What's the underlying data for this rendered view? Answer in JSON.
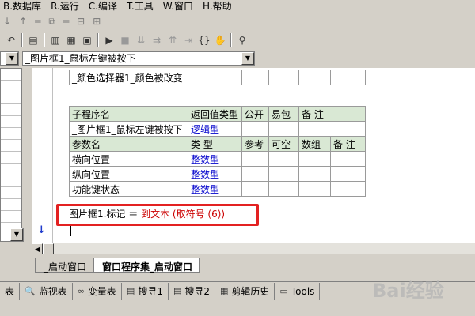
{
  "menu": [
    "B.数据库",
    "R.运行",
    "C.编译",
    "T.工具",
    "W.窗口",
    "H.帮助"
  ],
  "toolbar_top": [
    "↓",
    "↑",
    "═",
    "⧉",
    "═",
    "⊟",
    "⊞"
  ],
  "combo": {
    "left_value": "",
    "main_value": "_图片框1_鼠标左键被按下"
  },
  "top_table": {
    "row": "_颜色选择器1_颜色被改变"
  },
  "sub_table": {
    "headers": [
      "子程序名",
      "返回值类型",
      "公开",
      "易包",
      "备 注"
    ],
    "row": [
      "_图片框1_鼠标左键被按下",
      "逻辑型",
      "",
      "",
      ""
    ]
  },
  "param_table": {
    "headers": [
      "参数名",
      "类 型",
      "参考",
      "可空",
      "数组",
      "备 注"
    ],
    "rows": [
      [
        "横向位置",
        "整数型"
      ],
      [
        "纵向位置",
        "整数型"
      ],
      [
        "功能键状态",
        "整数型"
      ]
    ]
  },
  "code": {
    "prefix": "图片框1.标记 ＝ ",
    "red": "到文本 (取符号 (6))"
  },
  "doc_tabs": {
    "tab1": "_启动窗口",
    "tab2": "窗口程序集_启动窗口"
  },
  "bottom_tabs": [
    {
      "label": "表",
      "icon": ""
    },
    {
      "label": "监视表",
      "icon": "magnifier-icon"
    },
    {
      "label": "变量表",
      "icon": "glasses-icon"
    },
    {
      "label": "搜寻1",
      "icon": "search-list-icon"
    },
    {
      "label": "搜寻2",
      "icon": "search-list-icon"
    },
    {
      "label": "剪辑历史",
      "icon": "clipboard-icon"
    },
    {
      "label": "Tools",
      "icon": "window-icon"
    }
  ],
  "watermark": "Bai经验"
}
